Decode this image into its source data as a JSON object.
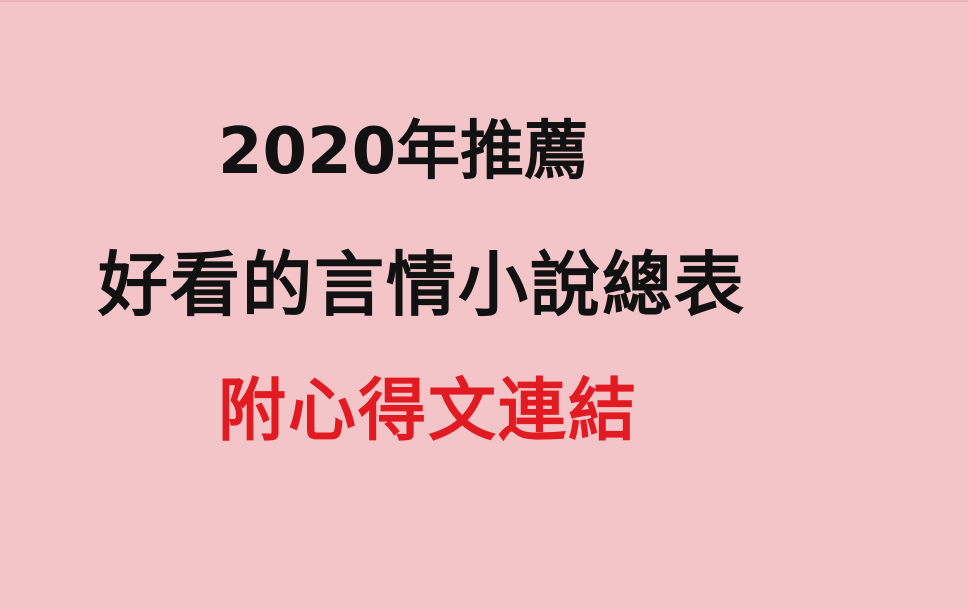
{
  "banner": {
    "title_line_1": "2020年推薦",
    "title_line_2": "好看的言情小說總表",
    "title_line_3": "附心得文連結"
  },
  "colors": {
    "background": "#f4c5c8",
    "primary_text": "#111111",
    "accent_text": "#e21b23"
  }
}
